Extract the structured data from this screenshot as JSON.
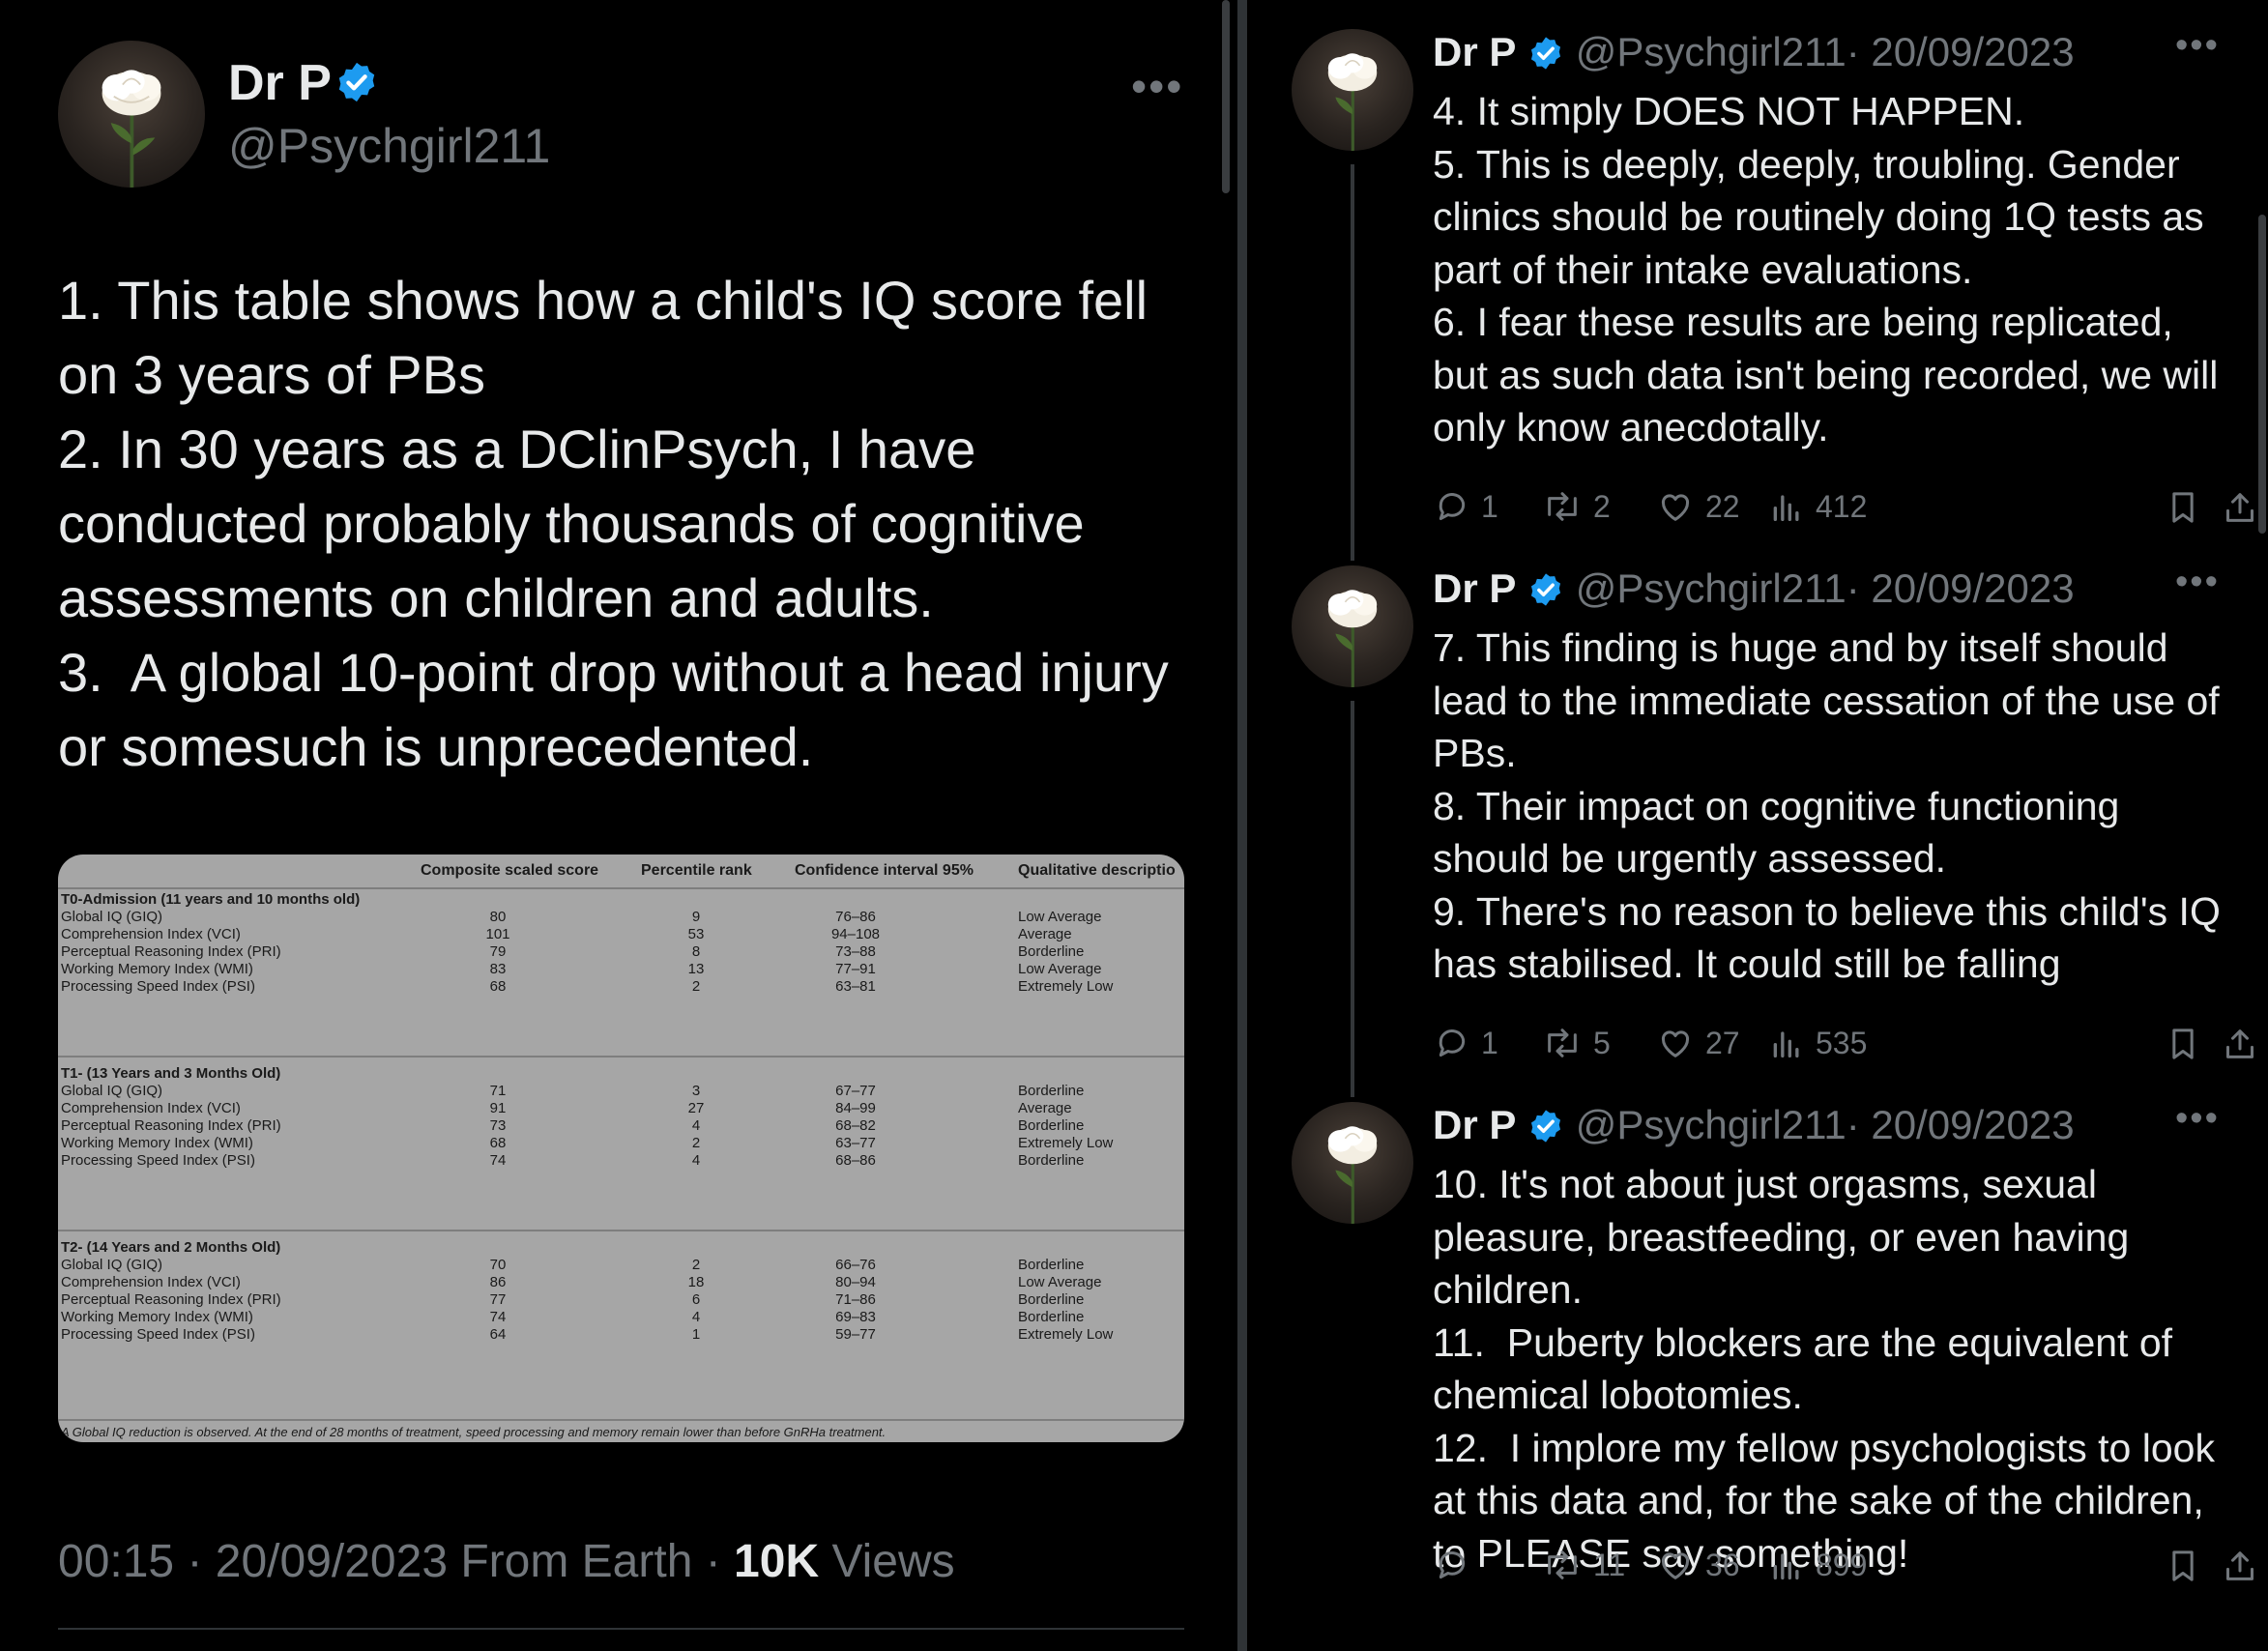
{
  "main_tweet": {
    "author_name": "Dr P",
    "author_handle": "@Psychgirl211",
    "text": "1. This table shows how a child's IQ score fell on 3 years of PBs\n2. In 30 years as a DClinPsych, I have conducted probably thousands of cognitive assessments on children and adults.\n3.  A global 10-point drop without a head injury or somesuch is unprecedented.",
    "meta_time": "00:15 · 20/09/2023 From Earth · ",
    "views_count": "10K",
    "views_label": " Views"
  },
  "table": {
    "headers": [
      "Composite scaled score",
      "Percentile rank",
      "Confidence interval 95%",
      "Qualitative descriptio"
    ],
    "sections": [
      {
        "title": "T0-Admission (11 years and 10 months old)",
        "rows": [
          [
            "Global IQ (GIQ)",
            "80",
            "9",
            "76–86",
            "Low Average"
          ],
          [
            "Comprehension Index (VCI)",
            "101",
            "53",
            "94–108",
            "Average"
          ],
          [
            "Perceptual Reasoning Index (PRI)",
            "79",
            "8",
            "73–88",
            "Borderline"
          ],
          [
            "Working Memory Index (WMI)",
            "83",
            "13",
            "77–91",
            "Low Average"
          ],
          [
            "Processing Speed Index (PSI)",
            "68",
            "2",
            "63–81",
            "Extremely Low"
          ]
        ]
      },
      {
        "title": "T1- (13 Years and 3 Months Old)",
        "rows": [
          [
            "Global IQ (GIQ)",
            "71",
            "3",
            "67–77",
            "Borderline"
          ],
          [
            "Comprehension Index (VCI)",
            "91",
            "27",
            "84–99",
            "Average"
          ],
          [
            "Perceptual Reasoning Index (PRI)",
            "73",
            "4",
            "68–82",
            "Borderline"
          ],
          [
            "Working Memory Index (WMI)",
            "68",
            "2",
            "63–77",
            "Extremely Low"
          ],
          [
            "Processing Speed Index (PSI)",
            "74",
            "4",
            "68–86",
            "Borderline"
          ]
        ]
      },
      {
        "title": "T2- (14 Years and 2 Months Old)",
        "rows": [
          [
            "Global IQ (GIQ)",
            "70",
            "2",
            "66–76",
            "Borderline"
          ],
          [
            "Comprehension Index (VCI)",
            "86",
            "18",
            "80–94",
            "Low Average"
          ],
          [
            "Perceptual Reasoning Index (PRI)",
            "77",
            "6",
            "71–86",
            "Borderline"
          ],
          [
            "Working Memory Index (WMI)",
            "74",
            "4",
            "69–83",
            "Borderline"
          ],
          [
            "Processing Speed Index (PSI)",
            "64",
            "1",
            "59–77",
            "Extremely Low"
          ]
        ]
      }
    ],
    "footnote": "A Global IQ reduction is observed. At the end of 28 months of treatment, speed processing and memory remain lower than before GnRHa treatment."
  },
  "replies": [
    {
      "author_name": "Dr P",
      "author_handle": "@Psychgirl211",
      "date": "· 20/09/2023",
      "text": "4. It simply DOES NOT HAPPEN.\n5. This is deeply, deeply, troubling. Gender clinics should be routinely doing 1Q tests as part of their intake evaluations.\n6. I fear these results are being replicated, but as such data isn't being recorded, we will only know anecdotally.",
      "replies": "1",
      "reposts": "2",
      "likes": "22",
      "views": "412"
    },
    {
      "author_name": "Dr P",
      "author_handle": "@Psychgirl211",
      "date": "· 20/09/2023",
      "text": "7. This finding is huge and by itself should lead to the immediate cessation of the use of PBs.\n8. Their impact on cognitive functioning should be urgently assessed.\n9. There's no reason to believe this child's IQ has stabilised. It could still be falling",
      "replies": "1",
      "reposts": "5",
      "likes": "27",
      "views": "535"
    },
    {
      "author_name": "Dr P",
      "author_handle": "@Psychgirl211",
      "date": "· 20/09/2023",
      "text": "10. It's not about just orgasms, sexual pleasure, breastfeeding, or even having children.\n11.  Puberty blockers are the equivalent of chemical lobotomies.\n12.  I implore my fellow psychologists to look at this data and, for the sake of the children, to PLEASE say something!",
      "replies": "",
      "reposts": "11",
      "likes": "36",
      "views": "899"
    }
  ],
  "icons": {
    "verified": "verified-badge-icon",
    "more": "more-icon",
    "reply": "reply-icon",
    "repost": "repost-icon",
    "like": "like-icon",
    "views": "views-icon",
    "bookmark": "bookmark-icon",
    "share": "share-icon"
  },
  "colors": {
    "background": "#000000",
    "text": "#e7e9ea",
    "secondary_text": "#71767b",
    "verified_blue": "#1d9bf0",
    "table_bg": "#a6a6a6"
  }
}
